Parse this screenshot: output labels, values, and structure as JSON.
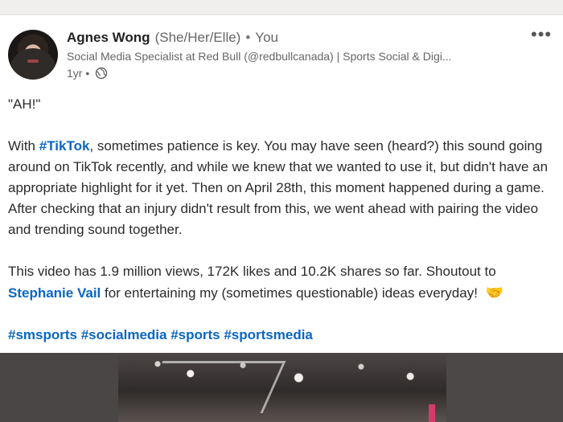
{
  "post": {
    "author": {
      "name": "Agnes Wong",
      "pronouns": "(She/Her/Elle)",
      "separator": "•",
      "relationship": "You",
      "headline": "Social Media Specialist at Red Bull (@redbullcanada) | Sports Social & Digi...",
      "time": "1yr",
      "time_separator": "•",
      "visibility_icon": "globe-icon"
    },
    "menu_icon": "more-horizontal-icon",
    "body": {
      "p1": "\"AH!\"",
      "p2_prefix": "With ",
      "p2_hashtag": "#TikTok",
      "p2_suffix": ", sometimes patience is key. You may have seen (heard?) this sound going around on TikTok recently, and while we knew that we wanted to use it, but didn't have an appropriate highlight for it yet. Then on April 28th, this moment happened during a game. After checking that an injury didn't result from this, we went ahead with pairing the video and trending sound together.",
      "p3_prefix": "This video has 1.9 million views, 172K likes and 10.2K shares so far. Shoutout to ",
      "p3_mention": "Stephanie Vail",
      "p3_suffix": " for entertaining my (sometimes questionable) ideas everyday! ",
      "p3_emoji": "🤝",
      "hashtags": "#smsports #socialmedia #sports #sportsmedia"
    }
  },
  "colors": {
    "accent_link": "#0a66c2",
    "muted_text": "#666666"
  }
}
